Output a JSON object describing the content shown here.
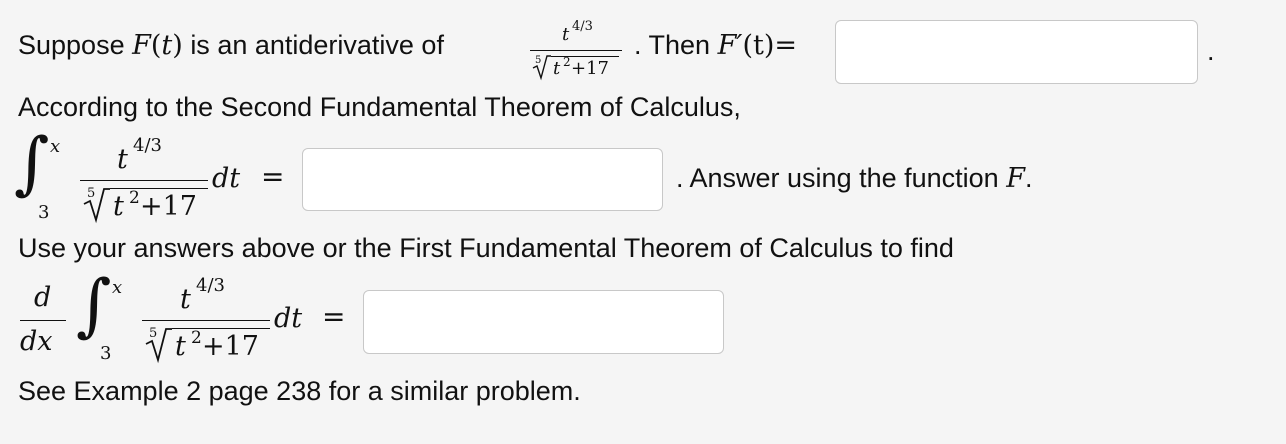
{
  "problem": {
    "line1": {
      "prefix": "Suppose",
      "func": "F",
      "var_paren_open": "(",
      "var": "t",
      "var_paren_close": ")",
      "middle": "is an antiderivative of",
      "then": ". Then",
      "deriv": "F′",
      "eq": "(t)=",
      "period": "."
    },
    "line2": "According to the Second Fundamental Theorem of Calculus,",
    "line3_suffix": ". Answer using the function",
    "line3_func": "F",
    "line3_period": ".",
    "line4": "Use your answers above or the First Fundamental Theorem of Calculus to find",
    "footer": "See Example 2 page 238 for a similar problem."
  },
  "integrand": {
    "numerator_base": "t",
    "numerator_exp": "4/3",
    "root_index": "5",
    "denominator_base": "t",
    "denominator_exp": "2",
    "denominator_plus": "+17"
  },
  "integral": {
    "lower": "3",
    "upper": "x",
    "dt": "dt",
    "equals": "="
  },
  "derivative": {
    "d": "d",
    "dx": "dx"
  },
  "answers": {
    "answer1_value": "",
    "answer2_value": "",
    "answer3_value": ""
  }
}
